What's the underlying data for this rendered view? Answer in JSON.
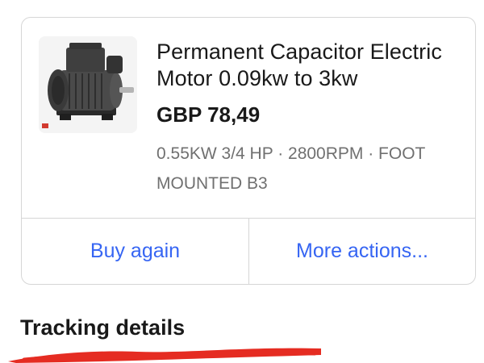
{
  "order_item": {
    "image_alt": "Electric motor product photo",
    "title": "Permanent Capacitor Electric Motor 0.09kw to 3kw",
    "price": "GBP 78,49",
    "variant": "0.55KW 3/4 HP · 2800RPM · FOOT MOUNTED B3"
  },
  "actions": {
    "buy_again": "Buy again",
    "more_actions": "More actions..."
  },
  "tracking": {
    "title": "Tracking details"
  },
  "colors": {
    "link": "#3665f3",
    "text": "#191919",
    "muted": "#707070",
    "redaction": "#e52c22"
  }
}
